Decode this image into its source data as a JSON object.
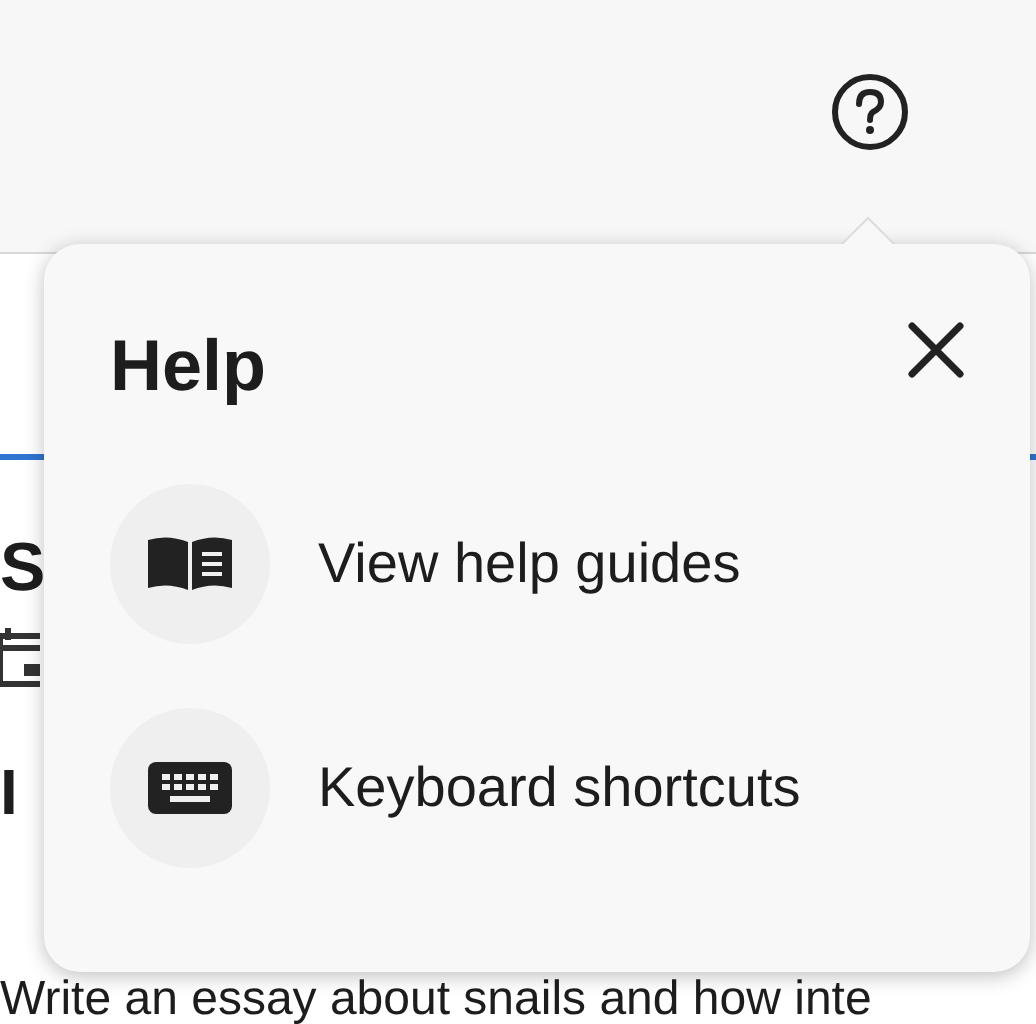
{
  "background": {
    "heading": "S",
    "subheading": "I",
    "prompt": "Write an essay about snails and how inte"
  },
  "popover": {
    "title": "Help",
    "items": [
      {
        "kind": "guides",
        "label": "View help guides"
      },
      {
        "kind": "keyboard",
        "label": "Keyboard shortcuts"
      }
    ]
  }
}
